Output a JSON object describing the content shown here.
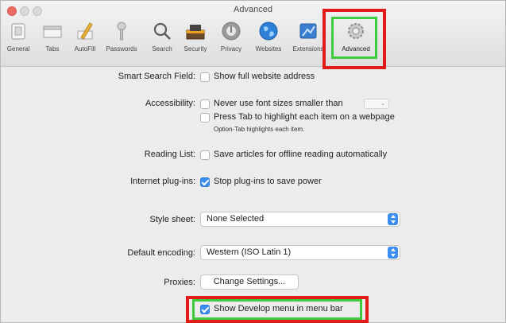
{
  "window": {
    "title": "Advanced"
  },
  "toolbar": {
    "tabs": [
      {
        "label": "General",
        "icon": "general-icon"
      },
      {
        "label": "Tabs",
        "icon": "tabs-icon"
      },
      {
        "label": "AutoFill",
        "icon": "autofill-icon"
      },
      {
        "label": "Passwords",
        "icon": "key-icon"
      },
      {
        "label": "Search",
        "icon": "search-icon"
      },
      {
        "label": "Security",
        "icon": "security-icon"
      },
      {
        "label": "Privacy",
        "icon": "privacy-icon"
      },
      {
        "label": "Websites",
        "icon": "globe-icon"
      },
      {
        "label": "Extensions",
        "icon": "extensions-icon"
      },
      {
        "label": "Advanced",
        "icon": "gear-icon",
        "active": true
      }
    ]
  },
  "settings": {
    "smart_search": {
      "label": "Smart Search Field:",
      "checkbox": "Show full website address",
      "checked": false
    },
    "accessibility": {
      "label": "Accessibility:",
      "font_size": "Never use font sizes smaller than",
      "font_size_checked": false,
      "tab_highlight": "Press Tab to highlight each item on a webpage",
      "tab_highlight_checked": false,
      "note": "Option-Tab highlights each item."
    },
    "reading_list": {
      "label": "Reading List:",
      "checkbox": "Save articles for offline reading automatically",
      "checked": false
    },
    "plugins": {
      "label": "Internet plug-ins:",
      "checkbox": "Stop plug-ins to save power",
      "checked": true
    },
    "style_sheet": {
      "label": "Style sheet:",
      "value": "None Selected"
    },
    "encoding": {
      "label": "Default encoding:",
      "value": "Western (ISO Latin 1)"
    },
    "proxies": {
      "label": "Proxies:",
      "button": "Change Settings..."
    },
    "develop_menu": {
      "checkbox": "Show Develop menu in menu bar",
      "checked": true
    }
  },
  "colors": {
    "highlight_red": "#e11a1a",
    "highlight_green": "#3dcc3d",
    "accent": "#3b8df2"
  }
}
